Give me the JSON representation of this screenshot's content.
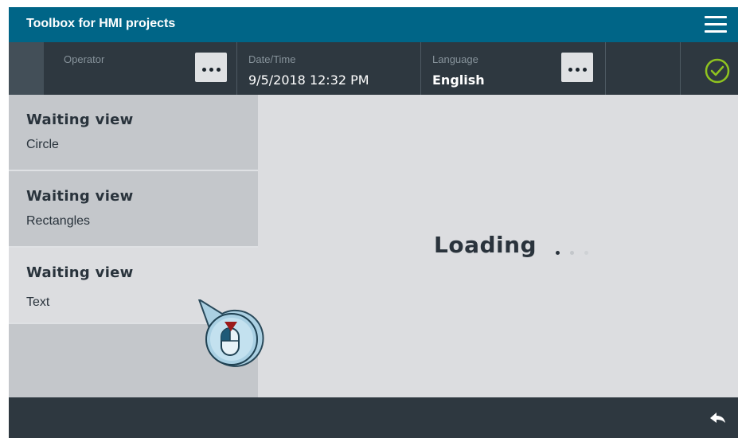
{
  "app": {
    "title": "Toolbox for HMI projects"
  },
  "statusbar": {
    "operator_label": "Operator",
    "datetime_label": "Date/Time",
    "datetime_value": "9/5/2018 12:32 PM",
    "language_label": "Language",
    "language_value": "English"
  },
  "sidepanel": {
    "items": [
      {
        "title": "Waiting view",
        "subtitle": "Circle"
      },
      {
        "title": "Waiting view",
        "subtitle": "Rectangles"
      },
      {
        "title": "Waiting view",
        "subtitle": "Text",
        "selected": true
      }
    ]
  },
  "content": {
    "loading_text": "Loading"
  },
  "icons": {
    "menu": "hamburger-icon",
    "status": "check-circle-icon",
    "back": "back-arrow-icon",
    "cursor": "touch-mouse-icon"
  },
  "colors": {
    "titlebar": "#006587",
    "statusbar": "#2e3840",
    "panel": "#c4c7cb",
    "content": "#dcdde0",
    "check": "#8fc31f",
    "cursor_accent": "#9b1b1b"
  }
}
